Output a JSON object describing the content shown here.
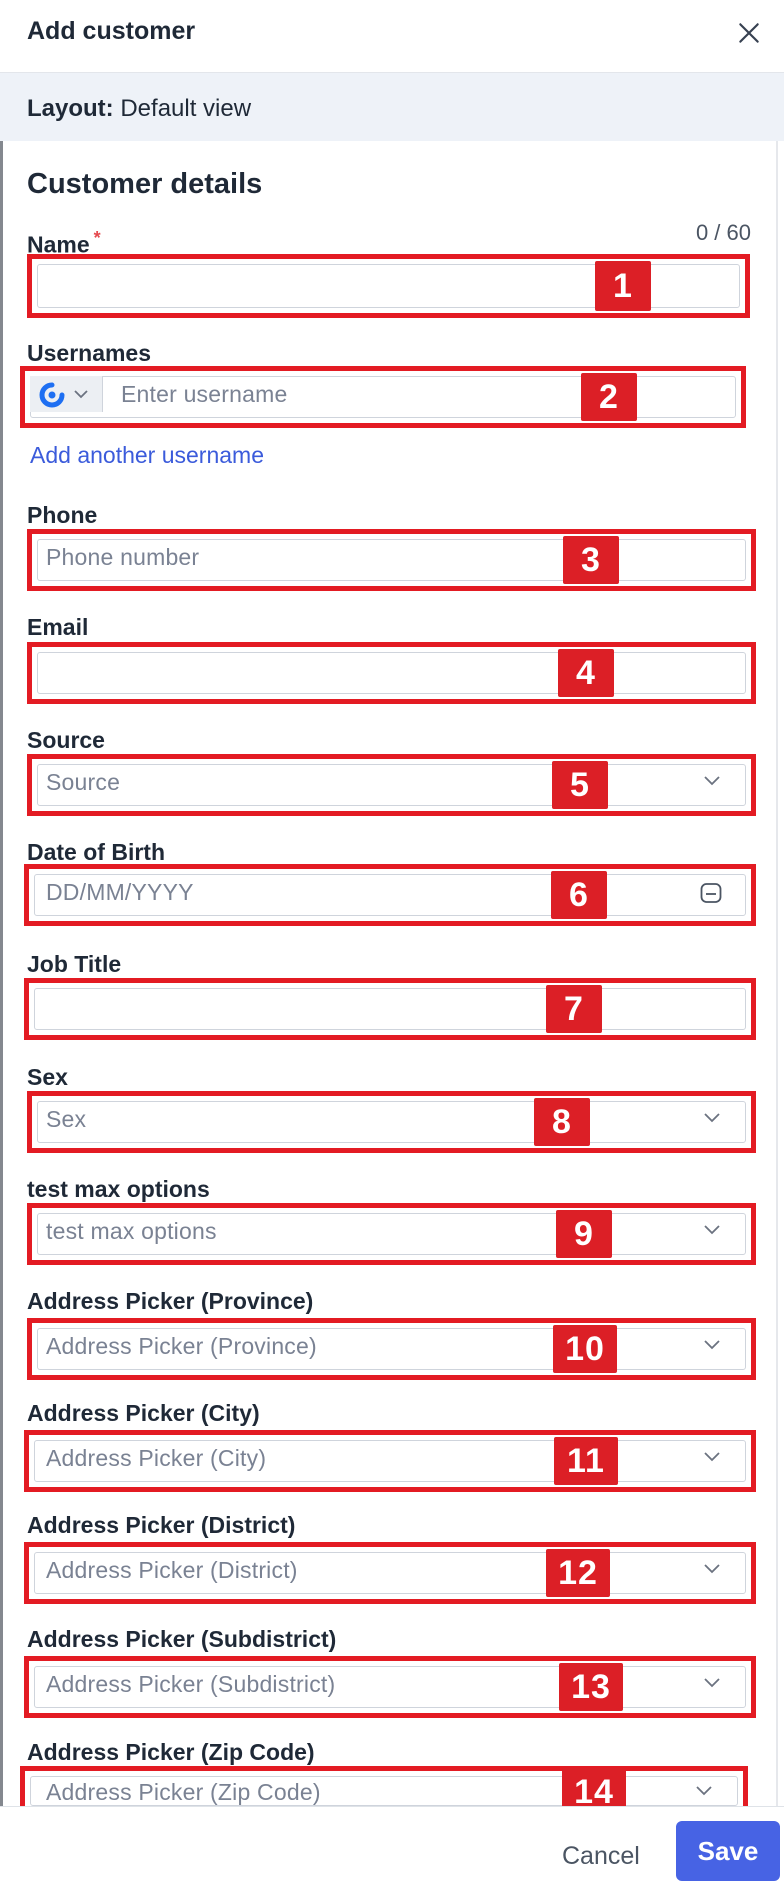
{
  "header": {
    "title": "Add customer"
  },
  "layout_bar": {
    "label": "Layout:",
    "value": "Default view"
  },
  "section_title": "Customer details",
  "fields": {
    "name": {
      "label": "Name",
      "required_mark": "*",
      "counter": "0 / 60",
      "badge": "1"
    },
    "usernames": {
      "label": "Usernames",
      "placeholder": "Enter username",
      "badge": "2",
      "add_link": "Add another username"
    },
    "phone": {
      "label": "Phone",
      "placeholder": "Phone number",
      "badge": "3"
    },
    "email": {
      "label": "Email",
      "badge": "4"
    },
    "source": {
      "label": "Source",
      "placeholder": "Source",
      "badge": "5"
    },
    "dob": {
      "label": "Date of Birth",
      "placeholder": "DD/MM/YYYY",
      "badge": "6"
    },
    "job_title": {
      "label": "Job Title",
      "badge": "7"
    },
    "sex": {
      "label": "Sex",
      "placeholder": "Sex",
      "badge": "8"
    },
    "test_max": {
      "label": "test max options",
      "placeholder": "test max options",
      "badge": "9"
    },
    "province": {
      "label": "Address Picker (Province)",
      "placeholder": "Address Picker (Province)",
      "badge": "10"
    },
    "city": {
      "label": "Address Picker (City)",
      "placeholder": "Address Picker (City)",
      "badge": "11"
    },
    "district": {
      "label": "Address Picker (District)",
      "placeholder": "Address Picker (District)",
      "badge": "12"
    },
    "subdistrict": {
      "label": "Address Picker (Subdistrict)",
      "placeholder": "Address Picker (Subdistrict)",
      "badge": "13"
    },
    "zip": {
      "label": "Address Picker (Zip Code)",
      "placeholder": "Address Picker (Zip Code)",
      "badge": "14"
    }
  },
  "footer": {
    "cancel_label": "Cancel",
    "save_label": "Save"
  },
  "colors": {
    "annotation_red": "#dc1f26",
    "primary": "#4763e4",
    "link": "#3b5bdb"
  }
}
